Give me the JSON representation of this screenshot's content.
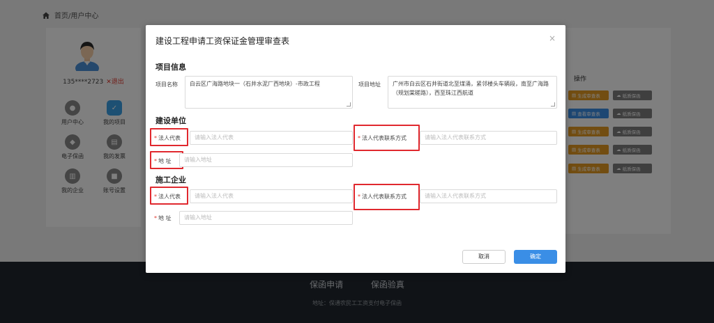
{
  "breadcrumb": {
    "text": "首页/用户中心",
    "icon": "home-icon"
  },
  "user": {
    "phone": "135****2723",
    "logout": "✕退出"
  },
  "nav": [
    {
      "label": "用户中心",
      "icon": "user-icon"
    },
    {
      "label": "我的项目",
      "icon": "project-icon",
      "active": true
    },
    {
      "label": "电子保函",
      "icon": "guarantee-icon"
    },
    {
      "label": "我的发票",
      "icon": "invoice-icon"
    },
    {
      "label": "我的企业",
      "icon": "company-icon"
    },
    {
      "label": "账号设置",
      "icon": "lock-icon"
    }
  ],
  "table": {
    "ops_header": "操作",
    "rows": [
      {
        "primary": "生成审查表",
        "primary_color": "orange",
        "secondary": "纸质保函"
      },
      {
        "primary": "查看审查表",
        "primary_color": "blue",
        "secondary": "纸质保函"
      },
      {
        "primary": "生成审查表",
        "primary_color": "orange",
        "secondary": "纸质保函"
      },
      {
        "primary": "生成审查表",
        "primary_color": "orange",
        "secondary": "纸质保函"
      },
      {
        "primary": "生成审查表",
        "primary_color": "orange",
        "secondary": "纸质保函"
      }
    ]
  },
  "footer": {
    "link1": "保函申请",
    "link2": "保函验真",
    "address": "地址：保通农民工工资支付电子保函"
  },
  "modal": {
    "title": "建设工程申请工资保证金管理审查表",
    "close": "×",
    "section_project": "项目信息",
    "project_name_label": "项目名称",
    "project_name_value": "白云区广海路地块一（石井水泥厂西地块）-市政工程",
    "project_addr_label": "项目地址",
    "project_addr_value": "广州市白云区石井街道北至煤涌，紧邻楼头车辆段，南至广海路（规划棠槎路），西至珠江西航道",
    "section_builder": "建设单位",
    "builder": {
      "rep_label": "法人代表",
      "rep_placeholder": "请输入法人代表",
      "contact_label": "法人代表联系方式",
      "contact_placeholder": "请输入法人代表联系方式",
      "addr_label": "地 址",
      "addr_placeholder": "请输入地址"
    },
    "section_contractor": "施工企业",
    "contractor": {
      "rep_label": "法人代表",
      "rep_placeholder": "请输入法人代表",
      "contact_label": "法人代表联系方式",
      "contact_placeholder": "请输入法人代表联系方式",
      "addr_label": "地 址",
      "addr_placeholder": "请输入地址"
    },
    "required_mark": "*",
    "cancel": "取消",
    "confirm": "确定"
  },
  "colors": {
    "accent": "#3a8ee6",
    "orange": "#e59b22",
    "required": "#e0382e",
    "footer_bg": "#20262e"
  }
}
